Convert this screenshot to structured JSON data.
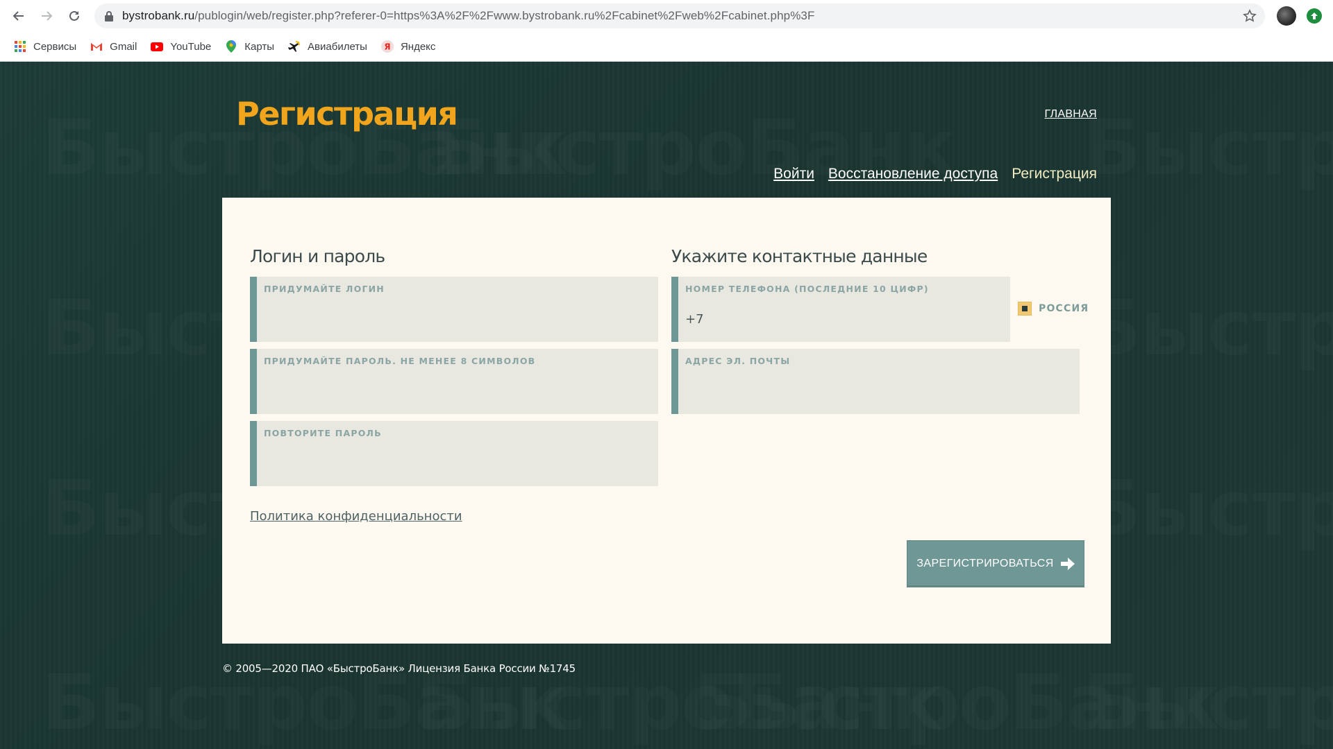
{
  "browser": {
    "url_host": "bystrobank.ru",
    "url_path": "/publogin/web/register.php?referer-0=https%3A%2F%2Fwww.bystrobank.ru%2Fcabinet%2Fweb%2Fcabinet.php%3F",
    "bookmarks": [
      {
        "label": "Сервисы",
        "icon": "apps-icon"
      },
      {
        "label": "Gmail",
        "icon": "gmail-icon"
      },
      {
        "label": "YouTube",
        "icon": "youtube-icon"
      },
      {
        "label": "Карты",
        "icon": "maps-icon"
      },
      {
        "label": "Авиабилеты",
        "icon": "plane-icon"
      },
      {
        "label": "Яндекс",
        "icon": "yandex-icon"
      }
    ]
  },
  "header": {
    "title": "Регистрация",
    "home_link": "ГЛАВНАЯ",
    "tabs": [
      {
        "label": "Войти",
        "active": false
      },
      {
        "label": "Восстановление доступа",
        "active": false
      },
      {
        "label": "Регистрация",
        "active": true
      }
    ]
  },
  "watermark_text": "БыстроБанк",
  "form": {
    "left_title": "Логин и пароль",
    "right_title": "Укажите контактные данные",
    "login_label": "Придумайте логин",
    "login_value": "",
    "password_label": "Придумайте пароль. Не менее 8 символов",
    "password_value": "",
    "repeat_label": "Повторите пароль",
    "repeat_value": "",
    "phone_label": "Номер телефона (последние 10 цифр)",
    "phone_value": "+7",
    "email_label": "Адрес эл. почты",
    "email_value": "",
    "country_label": "РОССИЯ",
    "country_checked": true,
    "privacy_link": "Политика конфиденциальности",
    "submit_label": "ЗАРЕГИСТРИРОВАТЬСЯ"
  },
  "footer": {
    "copyright": "© 2005—2020 ПАО «БыстроБанк» Лицензия Банка России №1745"
  },
  "colors": {
    "accent": "#f0a51c",
    "background": "#1c3733",
    "card": "#fdf9f1",
    "field": "#e8e8e1",
    "field_border": "#6d9895",
    "button": "#6e9795"
  }
}
